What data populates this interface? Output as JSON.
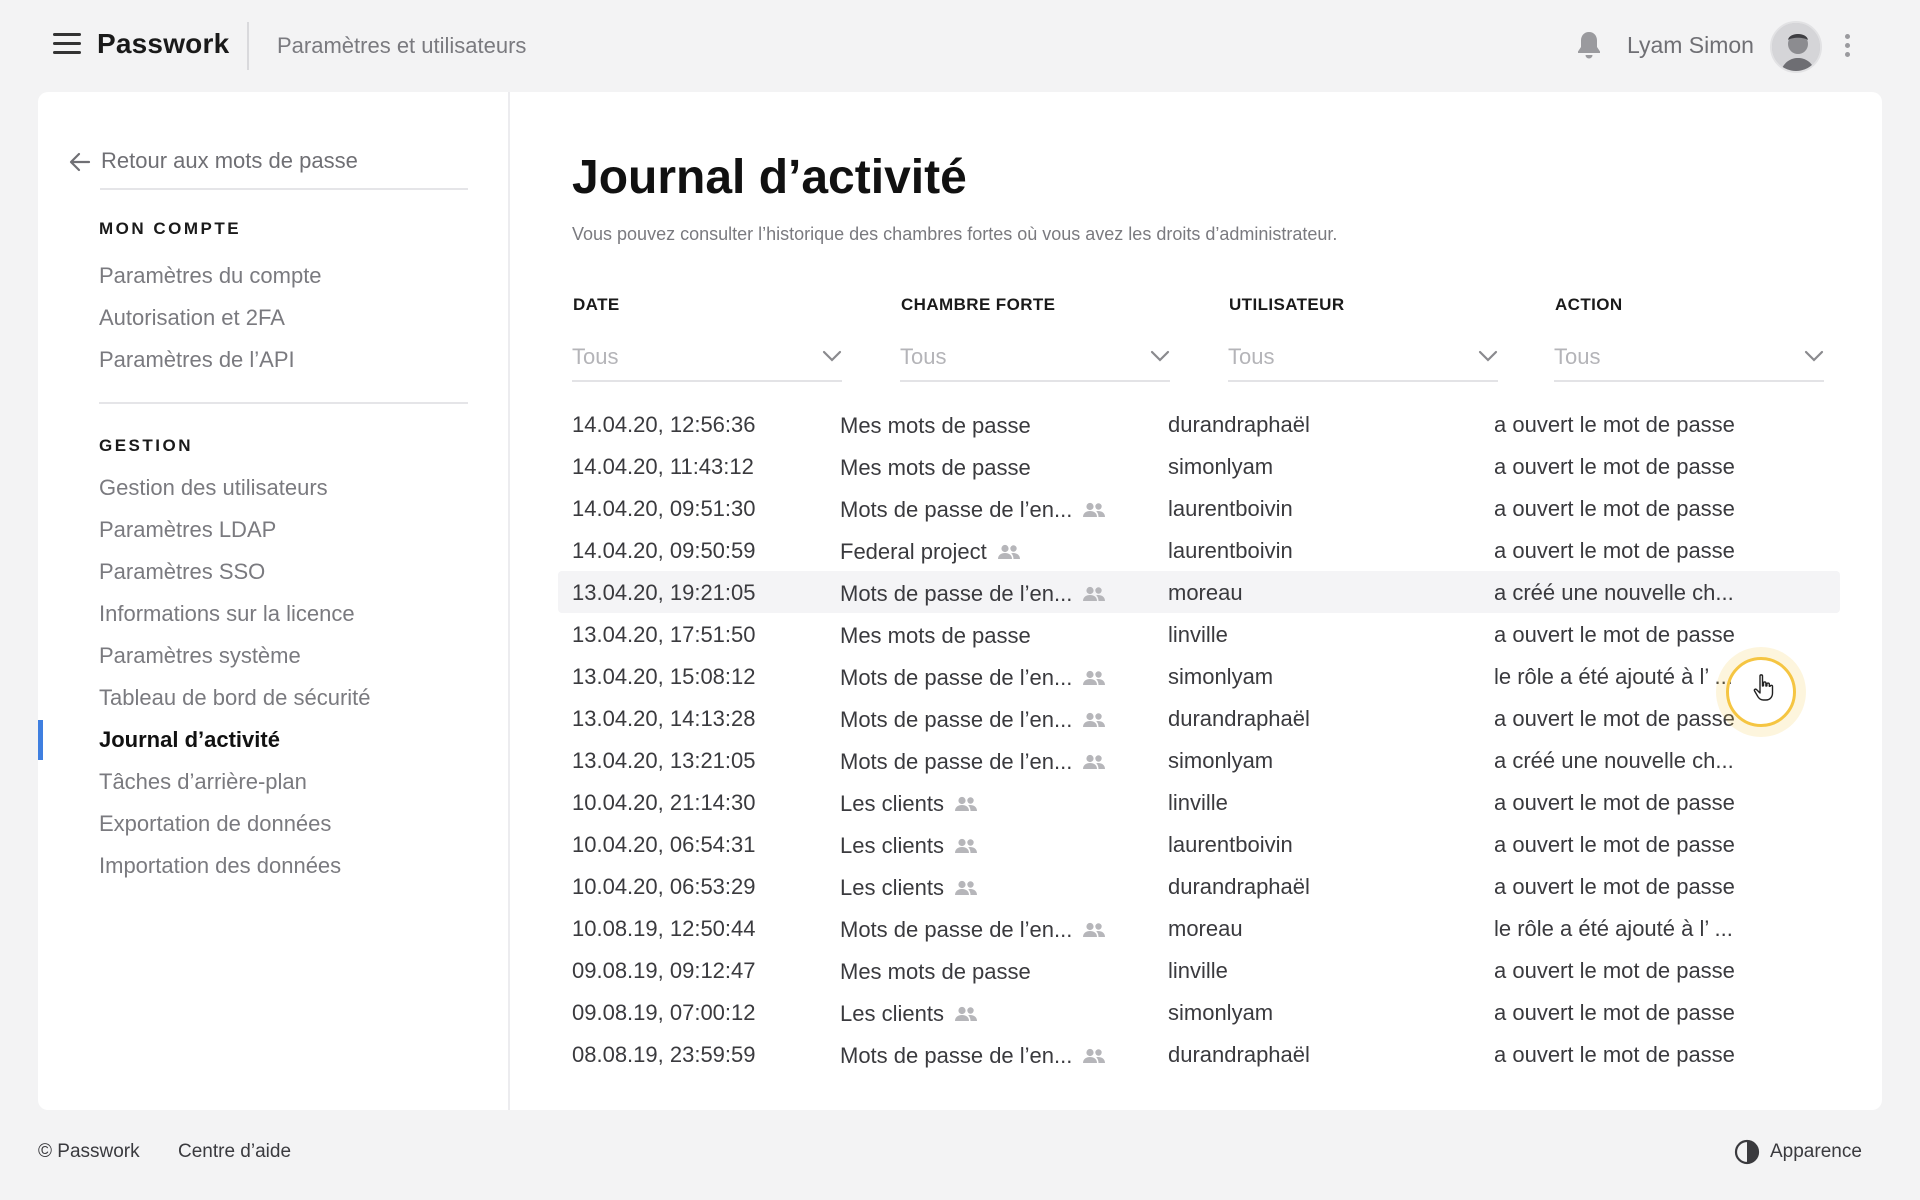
{
  "header": {
    "brand": "Passwork",
    "breadcrumb": "Paramètres et utilisateurs",
    "user_name": "Lyam Simon"
  },
  "sidebar": {
    "back_label": "Retour aux mots de passe",
    "account_title": "MON COMPTE",
    "account_items": [
      "Paramètres du compte",
      "Autorisation et 2FA",
      "Paramètres de l’API"
    ],
    "management_title": "GESTION",
    "management_items": [
      "Gestion des utilisateurs",
      "Paramètres LDAP",
      "Paramètres SSO",
      "Informations sur la licence",
      "Paramètres système",
      "Tableau de bord de sécurité",
      "Journal d’activité",
      "Tâches d’arrière-plan",
      "Exportation de données",
      "Importation des données"
    ],
    "active_item": "Journal d’activité"
  },
  "main": {
    "title": "Journal d’activité",
    "subtitle": "Vous pouvez consulter l’historique des chambres fortes où vous avez les droits d’administrateur.",
    "columns": [
      "DATE",
      "CHAMBRE FORTE",
      "UTILISATEUR",
      "ACTION"
    ],
    "filter_placeholder": "Tous",
    "rows": [
      {
        "date": "14.04.20, 12:56:36",
        "vault": "Mes mots de passe",
        "shared": false,
        "user": "durandraphaël",
        "action": "a ouvert le mot de passe"
      },
      {
        "date": "14.04.20, 11:43:12",
        "vault": "Mes mots de passe",
        "shared": false,
        "user": "simonlyam",
        "action": "a ouvert le mot de passe"
      },
      {
        "date": "14.04.20, 09:51:30",
        "vault": "Mots de passe de l’en...",
        "shared": true,
        "user": "laurentboivin",
        "action": "a ouvert le mot de passe"
      },
      {
        "date": "14.04.20, 09:50:59",
        "vault": "Federal project",
        "shared": true,
        "user": "laurentboivin",
        "action": "a ouvert le mot de passe"
      },
      {
        "date": "13.04.20, 19:21:05",
        "vault": "Mots de passe de l’en...",
        "shared": true,
        "user": "moreau",
        "action": "a créé une nouvelle ch..."
      },
      {
        "date": "13.04.20, 17:51:50",
        "vault": "Mes mots de passe",
        "shared": false,
        "user": "linville",
        "action": "a ouvert le mot de passe"
      },
      {
        "date": "13.04.20, 15:08:12",
        "vault": "Mots de passe de l’en...",
        "shared": true,
        "user": "simonlyam",
        "action": "le rôle a été ajouté à l’ ..."
      },
      {
        "date": "13.04.20, 14:13:28",
        "vault": "Mots de passe de l’en...",
        "shared": true,
        "user": "durandraphaël",
        "action": "a ouvert le mot de passe"
      },
      {
        "date": "13.04.20, 13:21:05",
        "vault": "Mots de passe de l’en...",
        "shared": true,
        "user": "simonlyam",
        "action": "a créé une nouvelle ch..."
      },
      {
        "date": "10.04.20, 21:14:30",
        "vault": "Les clients",
        "shared": true,
        "user": "linville",
        "action": "a ouvert le mot de passe"
      },
      {
        "date": "10.04.20, 06:54:31",
        "vault": "Les clients",
        "shared": true,
        "user": "laurentboivin",
        "action": "a ouvert le mot de passe"
      },
      {
        "date": "10.04.20, 06:53:29",
        "vault": "Les clients",
        "shared": true,
        "user": "durandraphaël",
        "action": "a ouvert le mot de passe"
      },
      {
        "date": "10.08.19, 12:50:44",
        "vault": "Mots de passe de l’en...",
        "shared": true,
        "user": "moreau",
        "action": "le rôle a été ajouté à l’ ..."
      },
      {
        "date": "09.08.19, 09:12:47",
        "vault": "Mes mots de passe",
        "shared": false,
        "user": "linville",
        "action": "a ouvert le mot de passe"
      },
      {
        "date": "09.08.19, 07:00:12",
        "vault": "Les clients",
        "shared": true,
        "user": "simonlyam",
        "action": "a ouvert le mot de passe"
      },
      {
        "date": "08.08.19, 23:59:59",
        "vault": "Mots de passe de l’en...",
        "shared": true,
        "user": "durandraphaël",
        "action": "a ouvert le mot de passe"
      }
    ],
    "highlighted_row": 4
  },
  "footer": {
    "copyright": "© Passwork",
    "help": "Centre d’aide",
    "appearance": "Apparence"
  },
  "colors": {
    "accent": "#3f7fe0",
    "cursor_ring": "#f5c542",
    "background": "#f3f3f4"
  },
  "icons": [
    "menu-icon",
    "bell-icon",
    "more-vertical-icon",
    "arrow-left-icon",
    "chevron-down-icon",
    "group-icon",
    "contrast-icon"
  ]
}
